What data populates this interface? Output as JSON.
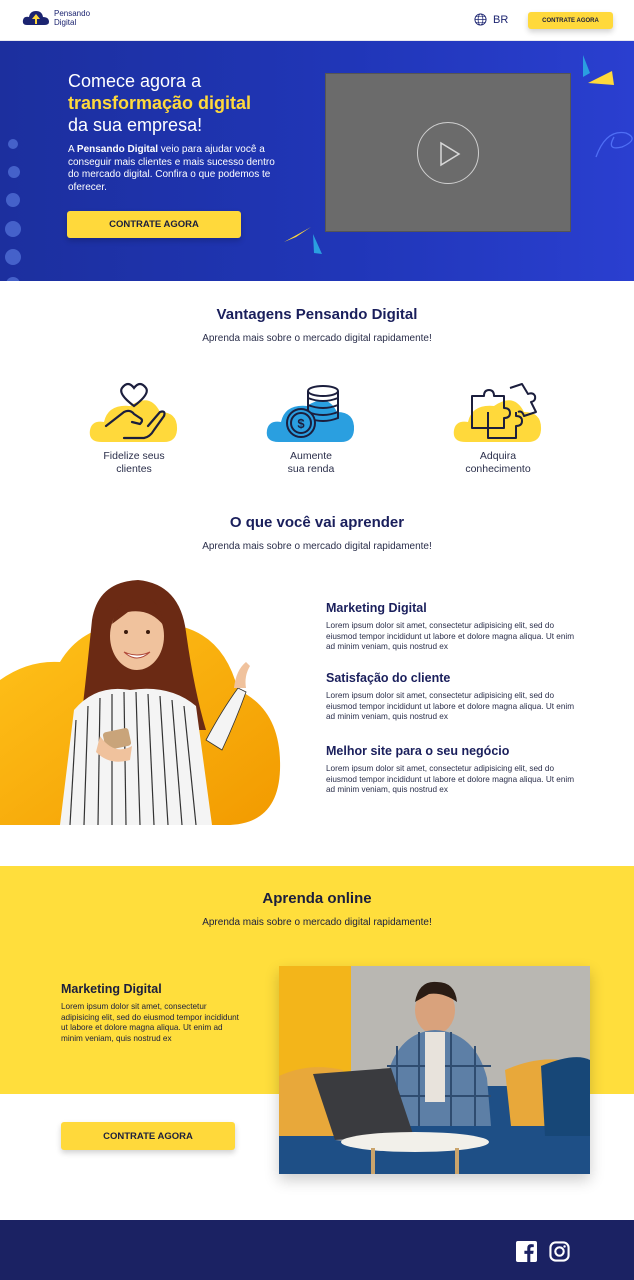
{
  "header": {
    "logo_line1": "Pensando",
    "logo_line2": "Digital",
    "language": "BR",
    "cta_label": "CONTRATE AGORA"
  },
  "hero": {
    "title_line1": "Comece agora a",
    "title_highlight": "transformação digital",
    "title_line3": "da sua empresa!",
    "text_prefix": "A ",
    "text_brand": "Pensando Digital",
    "text_rest": " veio para ajudar você a conseguir mais clientes e mais sucesso dentro do mercado digital. Confira o que podemos te oferecer.",
    "cta_label": "CONTRATE AGORA"
  },
  "advantages": {
    "title": "Vantagens Pensando Digital",
    "subtitle": "Aprenda mais sobre o mercado digital rapidamente!",
    "items": [
      {
        "line1": "Fidelize seus",
        "line2": "clientes",
        "icon": "heart-hand-icon"
      },
      {
        "line1": "Aumente",
        "line2": "sua renda",
        "icon": "coins-icon"
      },
      {
        "line1": "Adquira",
        "line2": "conhecimento",
        "icon": "puzzle-icon"
      }
    ]
  },
  "learn": {
    "title": "O que você vai aprender",
    "subtitle": "Aprenda mais sobre o mercado digital rapidamente!",
    "topics": [
      {
        "title": "Marketing Digital",
        "text": "Lorem ipsum dolor sit amet, consectetur adipisicing elit, sed do eiusmod tempor incididunt ut labore et dolore magna aliqua. Ut enim ad minim veniam, quis nostrud ex"
      },
      {
        "title": "Satisfação do cliente",
        "text": "Lorem ipsum dolor sit amet, consectetur adipisicing elit, sed do eiusmod tempor incididunt ut labore et dolore magna aliqua. Ut enim ad minim veniam, quis nostrud ex"
      },
      {
        "title": "Melhor site para o seu negócio",
        "text": "Lorem ipsum dolor sit amet, consectetur adipisicing elit, sed do eiusmod tempor incididunt ut labore et dolore magna aliqua. Ut enim ad minim veniam, quis nostrud ex"
      }
    ]
  },
  "online": {
    "title": "Aprenda online",
    "subtitle": "Aprenda mais sobre o mercado digital rapidamente!",
    "card_title": "Marketing Digital",
    "card_text": "Lorem ipsum dolor sit amet, consectetur adipisicing elit, sed do eiusmod tempor incididunt ut labore et dolore magna aliqua. Ut enim ad minim veniam, quis nostrud ex",
    "cta_label": "CONTRATE AGORA"
  },
  "footer": {
    "social": [
      "facebook-icon",
      "instagram-icon"
    ]
  },
  "colors": {
    "brand_blue": "#1c2f9e",
    "navy": "#1b2263",
    "yellow": "#ffd93b",
    "orange": "#f5a800",
    "sky": "#2a9fe0"
  }
}
